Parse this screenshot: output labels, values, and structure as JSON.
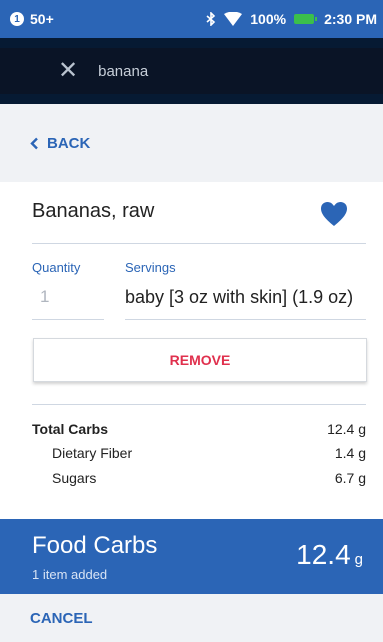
{
  "status_bar": {
    "left_badge": "1",
    "notification_count": "50+",
    "battery": "100%",
    "time": "2:30 PM",
    "icons": [
      "bluetooth-icon",
      "wifi-icon",
      "battery-icon"
    ]
  },
  "search": {
    "query": "banana",
    "close_icon": "close-icon"
  },
  "nav": {
    "back_label": "BACK"
  },
  "food": {
    "name": "Bananas, raw",
    "favorite_icon": "heart-icon",
    "quantity_label": "Quantity",
    "quantity_value": "1",
    "servings_label": "Servings",
    "servings_value": "baby [3 oz with skin] (1.9 oz)",
    "remove_label": "REMOVE"
  },
  "nutrition": [
    {
      "label": "Total Carbs",
      "value": "12.4 g"
    },
    {
      "label": "Dietary Fiber",
      "value": "1.4 g"
    },
    {
      "label": "Sugars",
      "value": "6.7 g"
    }
  ],
  "totals": {
    "title": "Food Carbs",
    "subtitle": "1 item added",
    "value": "12.4",
    "unit": "g"
  },
  "footer": {
    "cancel_label": "CANCEL"
  },
  "colors": {
    "primary": "#2b65b6",
    "status_bar": "#2b65b6",
    "search_bg": "#061a33",
    "remove": "#e0304d",
    "battery": "#3bbf4a"
  }
}
